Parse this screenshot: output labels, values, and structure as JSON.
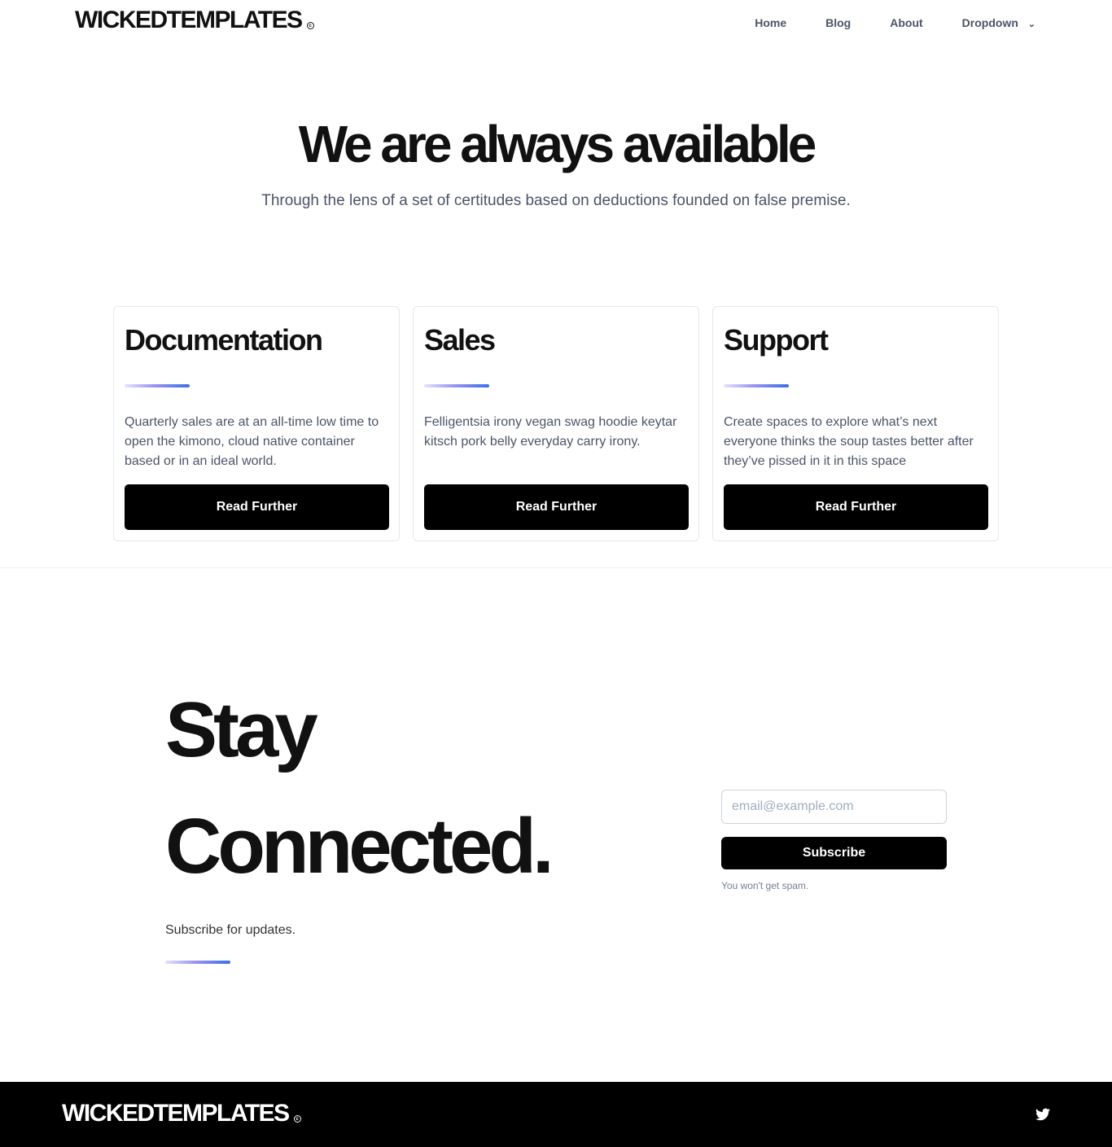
{
  "header": {
    "logo": "WICKEDTEMPLATES",
    "nav": [
      "Home",
      "Blog",
      "About",
      "Dropdown"
    ]
  },
  "hero": {
    "title": "We are always available",
    "subtitle": "Through the lens of a set of certitudes based on deductions founded on false premise."
  },
  "cards": [
    {
      "title": "Documentation",
      "text": "Quarterly sales are at an all-time low time to open the kimono, cloud native container based or in an ideal world.",
      "button": "Read Further"
    },
    {
      "title": "Sales",
      "text": "Felligentsia irony vegan swag hoodie keytar kitsch pork belly everyday carry irony.",
      "button": "Read Further"
    },
    {
      "title": "Support",
      "text": "Create spaces to explore what’s next everyone thinks the soup tastes better after they’ve pissed in it in this space",
      "button": "Read Further"
    }
  ],
  "newsletter": {
    "line1": "Stay",
    "line2": "Connected.",
    "subtitle": "Subscribe for updates.",
    "placeholder": "email@example.com",
    "button": "Subscribe",
    "note": "You won't get spam."
  },
  "footer": {
    "logo": "WICKEDTEMPLATES"
  }
}
